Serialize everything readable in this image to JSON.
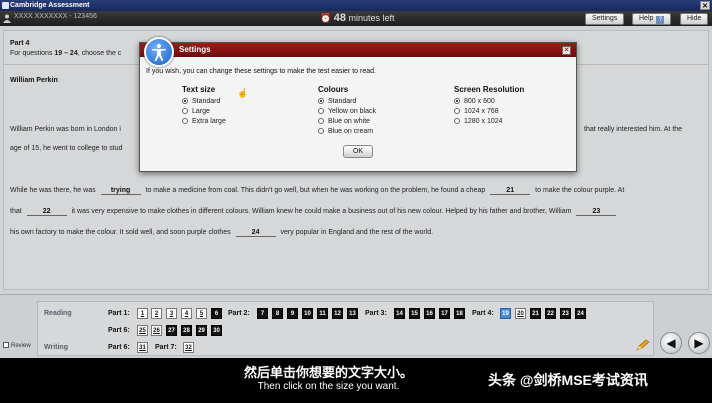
{
  "window": {
    "title": "Cambridge Assessment",
    "close_glyph": "✕"
  },
  "topbar": {
    "candidate": "XXXX XXXXXXX - 123456",
    "timer_value": "48",
    "timer_unit": "minutes left",
    "settings_label": "Settings",
    "help_label": "Help",
    "help_glyph": "?",
    "hide_label": "Hide"
  },
  "content": {
    "part_title": "Part 4",
    "instruction_prefix": "For questions ",
    "instruction_range": "19 – 24",
    "instruction_suffix": ", choose the c",
    "article_title": "William Perkin",
    "para1_line1_left": "William Perkin was born in London i",
    "para1_line1_right": "that really interested him. At the",
    "para1_line2": "age of 15, he went to college to stud",
    "line3_a": "While he was there, he was",
    "gap_trying": "trying",
    "line3_b": "to make a medicine from coal. This didn't go well, but when he was working on the problem, he found a cheap",
    "gap_21": "21",
    "line3_c": "to make the colour purple. At",
    "line4_a": "that",
    "gap_22": "22",
    "line4_b": "it was very expensive to make clothes in different colours. William knew he could make a business out of his new colour. Helped by his father and brother, William",
    "gap_23": "23",
    "line5_a": "his own factory to make the colour. It sold well, and soon purple clothes",
    "gap_24": "24",
    "line5_b": "very popular in England and the rest of the world."
  },
  "dialog": {
    "title": "Settings",
    "close_glyph": "✕",
    "intro": "If you wish, you can change these settings to make the test easier to read.",
    "text_size": {
      "heading": "Text size",
      "options": [
        "Standard",
        "Large",
        "Extra large"
      ],
      "selected": "Standard"
    },
    "colours": {
      "heading": "Colours",
      "options": [
        "Standard",
        "Yellow on black",
        "Blue on white",
        "Blue on cream"
      ],
      "selected": "Standard"
    },
    "resolution": {
      "heading": "Screen Resolution",
      "options": [
        "800 x 600",
        "1024 x 768",
        "1280 x 1024"
      ],
      "selected": "800 x 600"
    },
    "ok_label": "OK"
  },
  "nav": {
    "reading_label": "Reading",
    "writing_label": "Writing",
    "review_label": "Review",
    "reading_part1_label": "Part 1:",
    "reading_part2_label": "Part 2:",
    "reading_part3_label": "Part 3:",
    "reading_part4_label": "Part 4:",
    "reading_part5_label": "Part 5:",
    "reading_part6_label": "Part 6:",
    "writing_part6_label": "Part 6:",
    "writing_part7_label": "Part 7:",
    "q": {
      "1": "1",
      "2": "2",
      "3": "3",
      "4": "4",
      "5": "5",
      "6": "6",
      "7": "7",
      "8": "8",
      "9": "9",
      "10": "10",
      "11": "11",
      "12": "12",
      "13": "13",
      "14": "14",
      "15": "15",
      "16": "16",
      "17": "17",
      "18": "18",
      "19": "19",
      "20": "20",
      "21": "21",
      "22": "22",
      "23": "23",
      "24": "24",
      "25": "25",
      "26": "26",
      "27": "27",
      "28": "28",
      "29": "29",
      "30": "30",
      "31": "31",
      "32": "32"
    },
    "prev_glyph": "◀",
    "next_glyph": "▶"
  },
  "subtitles": {
    "chinese": "然后单击你想要的文字大小。",
    "english": "Then click on the size you want.",
    "watermark": "头条 @剑桥MSE考试资讯"
  },
  "colors": {
    "titlebar": "#17285c",
    "dialog_header": "#8a1414",
    "question_answered": "#ffffff",
    "question_unanswered": "#111111",
    "question_current": "#4b8bd6"
  }
}
